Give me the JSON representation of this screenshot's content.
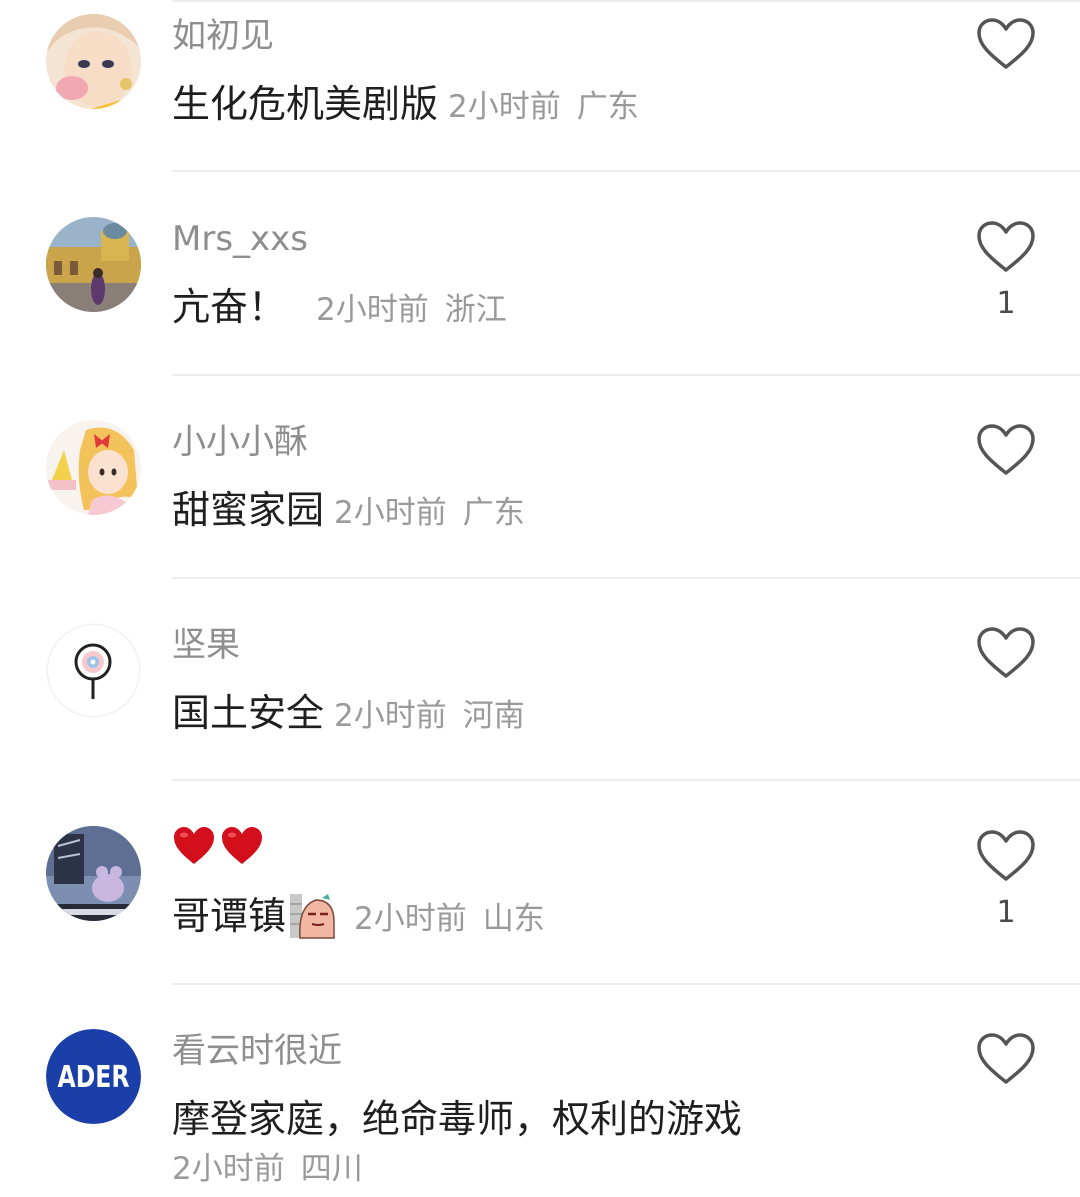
{
  "comments": [
    {
      "username": "如初见",
      "text": "生化危机美剧版",
      "time": "2小时前",
      "location": "广东",
      "likes": ""
    },
    {
      "username": "Mrs_xxs",
      "text": "亢奋！",
      "time": "2小时前",
      "location": "浙江",
      "likes": "1"
    },
    {
      "username": "小小小酥",
      "text": "甜蜜家园",
      "time": "2小时前",
      "location": "广东",
      "likes": ""
    },
    {
      "username": "坚果",
      "text": "国土安全",
      "time": "2小时前",
      "location": "河南",
      "likes": ""
    },
    {
      "username": "",
      "username_emoji": "red-heart-emoji x2",
      "text": "哥谭镇",
      "sticker": "peeking-bean-sticker",
      "time": "2小时前",
      "location": "山东",
      "likes": "1"
    },
    {
      "username": "看云时很近",
      "text": "摩登家庭，绝命毒师，权利的游戏",
      "time": "2小时前",
      "location": "四川",
      "likes": ""
    }
  ],
  "avatars": {
    "ader_text": "ADER"
  },
  "colors": {
    "username": "#8e8e8e",
    "content": "#1f1f1f",
    "meta": "#9a9a9a",
    "divider": "#ededed",
    "heart_outline": "#555555",
    "emoji_red": "#d40f1c",
    "ader_blue": "#1a3fa8"
  }
}
